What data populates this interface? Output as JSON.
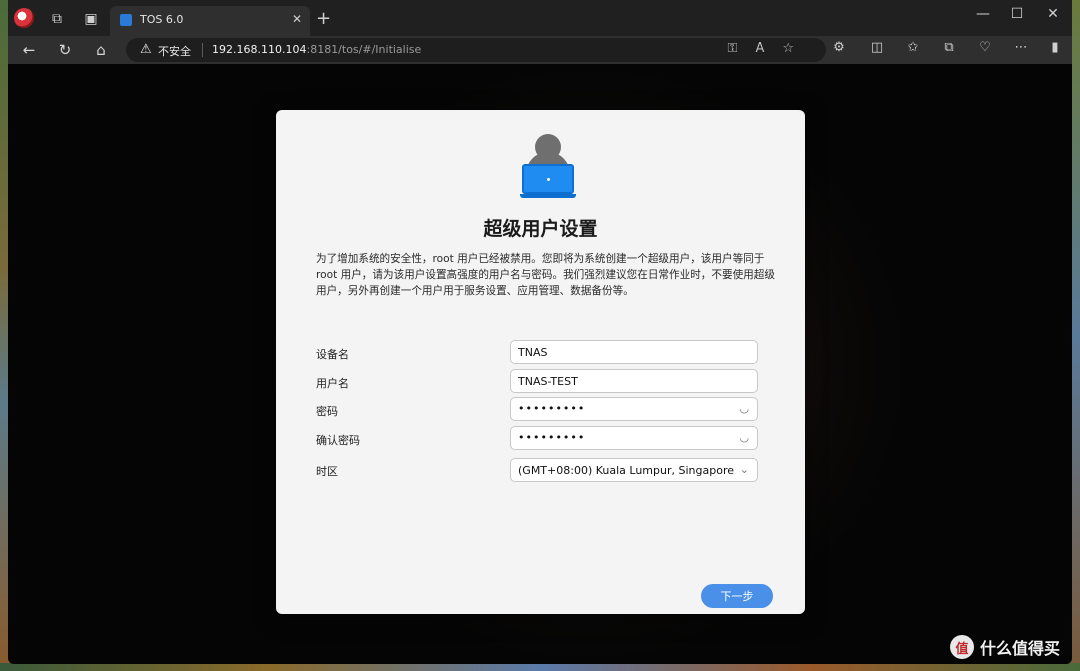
{
  "browser": {
    "tab_title": "TOS 6.0",
    "new_tab_glyph": "+",
    "close_tab_glyph": "✕",
    "minimize_glyph": "—",
    "maximize_glyph": "☐",
    "close_window_glyph": "✕",
    "security_label": "不安全",
    "url_host": "192.168.110.104",
    "url_path": ":8181/tos/#/Initialise"
  },
  "dialog": {
    "title": "超级用户设置",
    "description": "为了增加系统的安全性，root 用户已经被禁用。您即将为系统创建一个超级用户，该用户等同于 root 用户，请为该用户设置高强度的用户名与密码。我们强烈建议您在日常作业时，不要使用超级用户，另外再创建一个用户用于服务设置、应用管理、数据备份等。",
    "fields": [
      {
        "label": "设备名",
        "value": "TNAS"
      },
      {
        "label": "用户名",
        "value": "TNAS-TEST"
      },
      {
        "label": "密码",
        "value": "•••••••••"
      },
      {
        "label": "确认密码",
        "value": "•••••••••"
      },
      {
        "label": "时区",
        "value": "(GMT+08:00) Kuala Lumpur, Singapore"
      }
    ],
    "next_button": "下一步"
  },
  "watermark": {
    "logo_text": "值",
    "text": "什么值得买"
  },
  "colors": {
    "accent": "#4a90e8",
    "dialog_bg": "#f4f4f4",
    "browser_chrome": "#202020"
  }
}
